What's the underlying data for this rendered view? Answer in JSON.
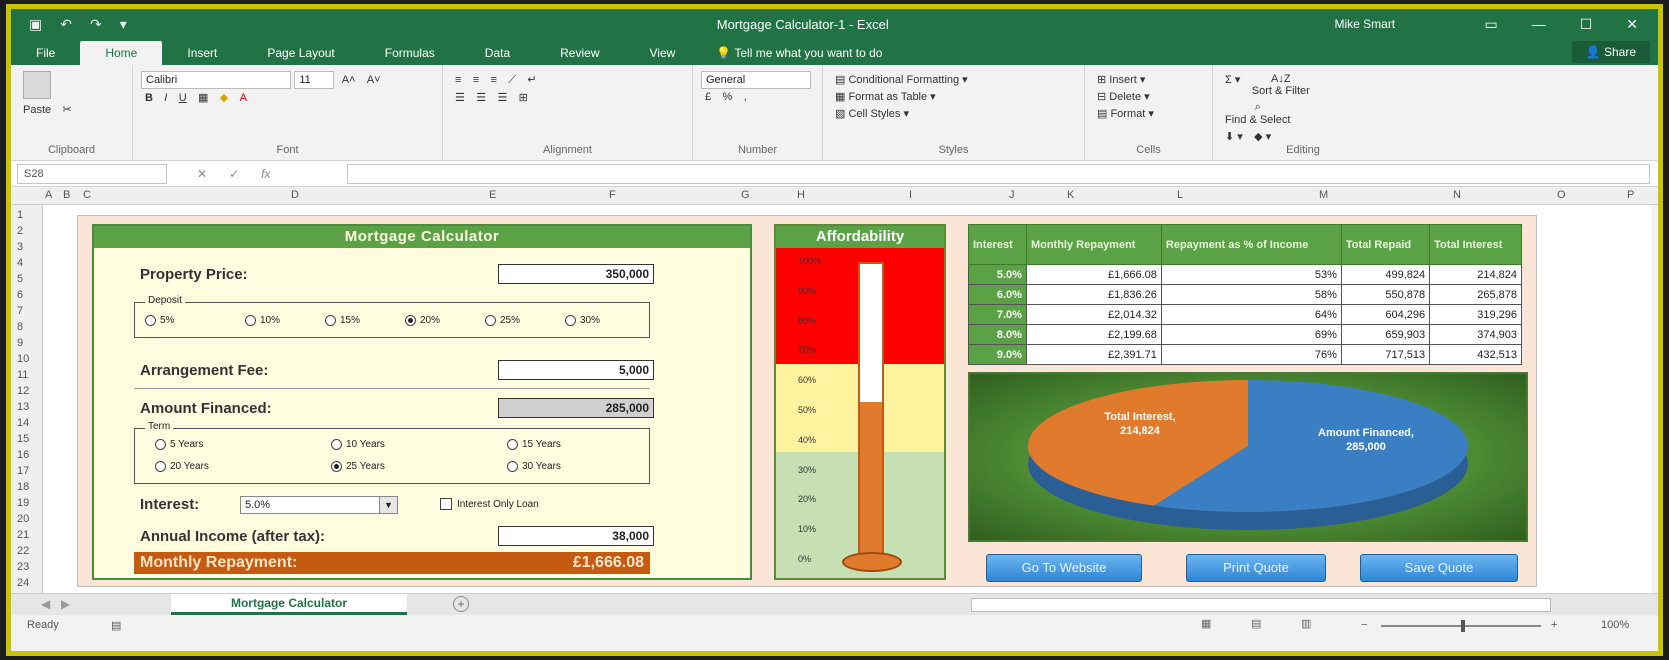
{
  "window": {
    "title": "Mortgage Calculator-1 - Excel",
    "user": "Mike Smart",
    "share_label": "Share"
  },
  "ribbon_tabs": [
    "File",
    "Home",
    "Insert",
    "Page Layout",
    "Formulas",
    "Data",
    "Review",
    "View"
  ],
  "tell_me": "Tell me what you want to do",
  "ribbon": {
    "paste": "Paste",
    "font_name": "Calibri",
    "font_size": "11",
    "number_format": "General",
    "conditional_formatting": "Conditional Formatting",
    "format_as_table": "Format as Table",
    "cell_styles": "Cell Styles",
    "insert": "Insert",
    "delete": "Delete",
    "format": "Format",
    "sort_filter": "Sort & Filter",
    "find_select": "Find & Select",
    "groups": [
      "Clipboard",
      "Font",
      "Alignment",
      "Number",
      "Styles",
      "Cells",
      "Editing"
    ]
  },
  "formula_bar": {
    "name_box": "S28",
    "fx": "fx"
  },
  "column_headers": [
    "A",
    "B",
    "C",
    "D",
    "E",
    "F",
    "G",
    "H",
    "I",
    "J",
    "K",
    "L",
    "M",
    "N",
    "O",
    "P"
  ],
  "row_headers": [
    "1",
    "2",
    "3",
    "4",
    "5",
    "6",
    "7",
    "8",
    "9",
    "10",
    "11",
    "12",
    "13",
    "14",
    "15",
    "16",
    "17",
    "18",
    "19",
    "20",
    "21",
    "22",
    "23",
    "24"
  ],
  "calculator": {
    "title": "Mortgage Calculator",
    "property_price_label": "Property Price:",
    "property_price": "350,000",
    "deposit_legend": "Deposit",
    "deposit_options": [
      "5%",
      "10%",
      "15%",
      "20%",
      "25%",
      "30%"
    ],
    "deposit_selected": "20%",
    "arrangement_fee_label": "Arrangement Fee:",
    "arrangement_fee": "5,000",
    "amount_financed_label": "Amount Financed:",
    "amount_financed": "285,000",
    "term_legend": "Term",
    "term_options": [
      "5 Years",
      "10 Years",
      "15 Years",
      "20 Years",
      "25 Years",
      "30 Years"
    ],
    "term_selected": "25 Years",
    "interest_label": "Interest:",
    "interest_value": "5.0%",
    "interest_only_label": "Interest Only Loan",
    "annual_income_label": "Annual Income (after tax):",
    "annual_income": "38,000",
    "monthly_repayment_label": "Monthly Repayment:",
    "monthly_repayment": "£1,666.08"
  },
  "affordability": {
    "title": "Affordability",
    "ticks": [
      "100%",
      "90%",
      "80%",
      "70%",
      "60%",
      "50%",
      "40%",
      "30%",
      "20%",
      "10%",
      "0%"
    ],
    "level_percent": 53,
    "colors": {
      "red": "#ff0000",
      "yellow": "#fff3a0",
      "green": "#c6e0b4",
      "mercury": "#e07b2d"
    }
  },
  "rate_table": {
    "headers": [
      "Interest",
      "Monthly Repayment",
      "Repayment as % of Income",
      "Total Repaid",
      "Total Interest"
    ],
    "rows": [
      [
        "5.0%",
        "£1,666.08",
        "53%",
        "499,824",
        "214,824"
      ],
      [
        "6.0%",
        "£1,836.26",
        "58%",
        "550,878",
        "265,878"
      ],
      [
        "7.0%",
        "£2,014.32",
        "64%",
        "604,296",
        "319,296"
      ],
      [
        "8.0%",
        "£2,199.68",
        "69%",
        "659,903",
        "374,903"
      ],
      [
        "9.0%",
        "£2,391.71",
        "76%",
        "717,513",
        "432,513"
      ]
    ]
  },
  "pie": {
    "slices": [
      {
        "label": "Total Interest, 214,824",
        "value": 214824,
        "color": "#e07b2d"
      },
      {
        "label": "Amount Financed, 285,000",
        "value": 285000,
        "color": "#3a7fc4"
      }
    ]
  },
  "buttons": {
    "go_to_website": "Go To Website",
    "print_quote": "Print Quote",
    "save_quote": "Save Quote"
  },
  "sheet_tab": "Mortgage Calculator",
  "status": {
    "ready": "Ready",
    "zoom": "100%"
  }
}
